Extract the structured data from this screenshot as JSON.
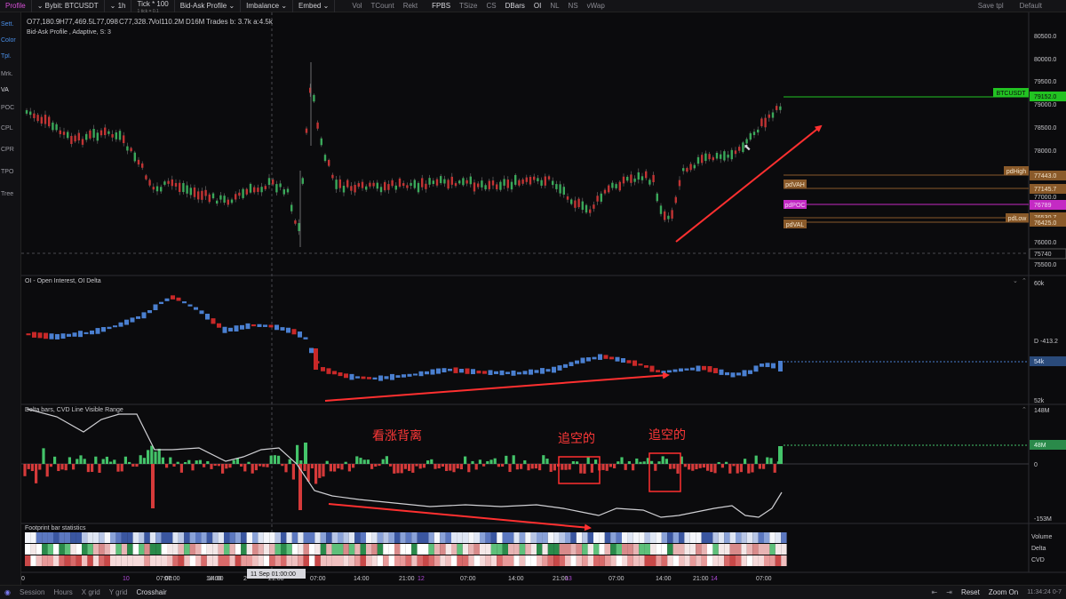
{
  "toolbar": {
    "profile": "Profile",
    "symbol": "Bybit: BTCUSDT",
    "timeframe": "1h",
    "tick": "Tick * 100",
    "tick_sub": "1 tick = 0.1",
    "chart_type": "Bid-Ask Profile",
    "imbalance": "Imbalance",
    "embed": "Embed",
    "items": [
      "Vol",
      "TCount",
      "Rekt",
      "FPBS",
      "TSize",
      "CS",
      "DBars",
      "OI",
      "NL",
      "NS",
      "vWap"
    ],
    "save_tpl": "Save tpl",
    "default": "Default"
  },
  "left_panel": [
    "Sett.",
    "Color",
    "Tpl.",
    "Mrk.",
    "VA",
    "POC",
    "CPL",
    "CPR",
    "TPO",
    "Tree"
  ],
  "main": {
    "ohlc": {
      "o": "O77,180.9",
      "h": "H77,469.5",
      "l": "L77,098",
      "c": "C77,328.7",
      "vol": "Vol110.2M",
      "d": "D16M",
      "trades": "Trades b: 3.7k a:4.5k"
    },
    "indicator_label": "Bid-Ask Profile , Adaptive, S: 3",
    "price_ticks": [
      "80500.0",
      "80000.0",
      "79500.0",
      "79000.0",
      "78500.0",
      "78000.0",
      "77500.0",
      "77000.0",
      "76500.0",
      "76000.0",
      "75500.0"
    ],
    "price_tags": [
      {
        "label": "BTCUSDT",
        "value": "79152.0",
        "color": "#22c322"
      },
      {
        "label": "pdHigh",
        "value": "77443.0",
        "color": "#8a5a2a"
      },
      {
        "label": "pdVAH",
        "value": "77145.7",
        "color": "#8a5a2a"
      },
      {
        "label": "pdPOC",
        "value": "76789",
        "color": "#c42ac4"
      },
      {
        "label": "pdLow",
        "value": "76530.7",
        "color": "#8a5a2a"
      },
      {
        "label": "pdVAL",
        "value": "76425.0",
        "color": "#8a5a2a"
      }
    ],
    "low_mark": "75740"
  },
  "oi_pane": {
    "label": "OI - Open Interest, OI Delta",
    "scale": [
      "60k",
      "D -413.2",
      "54k",
      "52k"
    ]
  },
  "delta_pane": {
    "label": "Delta bars, CVD Line Visible Range",
    "scale": [
      "148M",
      "48M",
      "0",
      "-153M"
    ],
    "annotations": [
      "看涨背离",
      "追空的",
      "追空的"
    ]
  },
  "footprint_pane": {
    "label": "Footprint bar statistics",
    "rows": [
      "Volume",
      "Delta",
      "CVD"
    ]
  },
  "time_axis": [
    "0",
    "07:00",
    "14:00",
    "21:00",
    "10",
    "07:00",
    "14:00",
    "2",
    "11 Sep 01:00:00",
    "07:00",
    "14:00",
    "21:00",
    "12",
    "07:00",
    "14:00",
    "21:00",
    "13",
    "07:00",
    "14:00",
    "21:00",
    "14",
    "07:00"
  ],
  "bottom": {
    "items": [
      "Session",
      "Hours",
      "X grid",
      "Y grid",
      "Crosshair"
    ],
    "reset": "Reset",
    "zoom": "Zoom On",
    "time": "11:34:24 0-7"
  },
  "colors": {
    "up": "#44c46a",
    "down": "#d63a3a",
    "oi_up": "#4a7fd0",
    "arrow": "#ff3030",
    "accent": "#d84fd8"
  }
}
